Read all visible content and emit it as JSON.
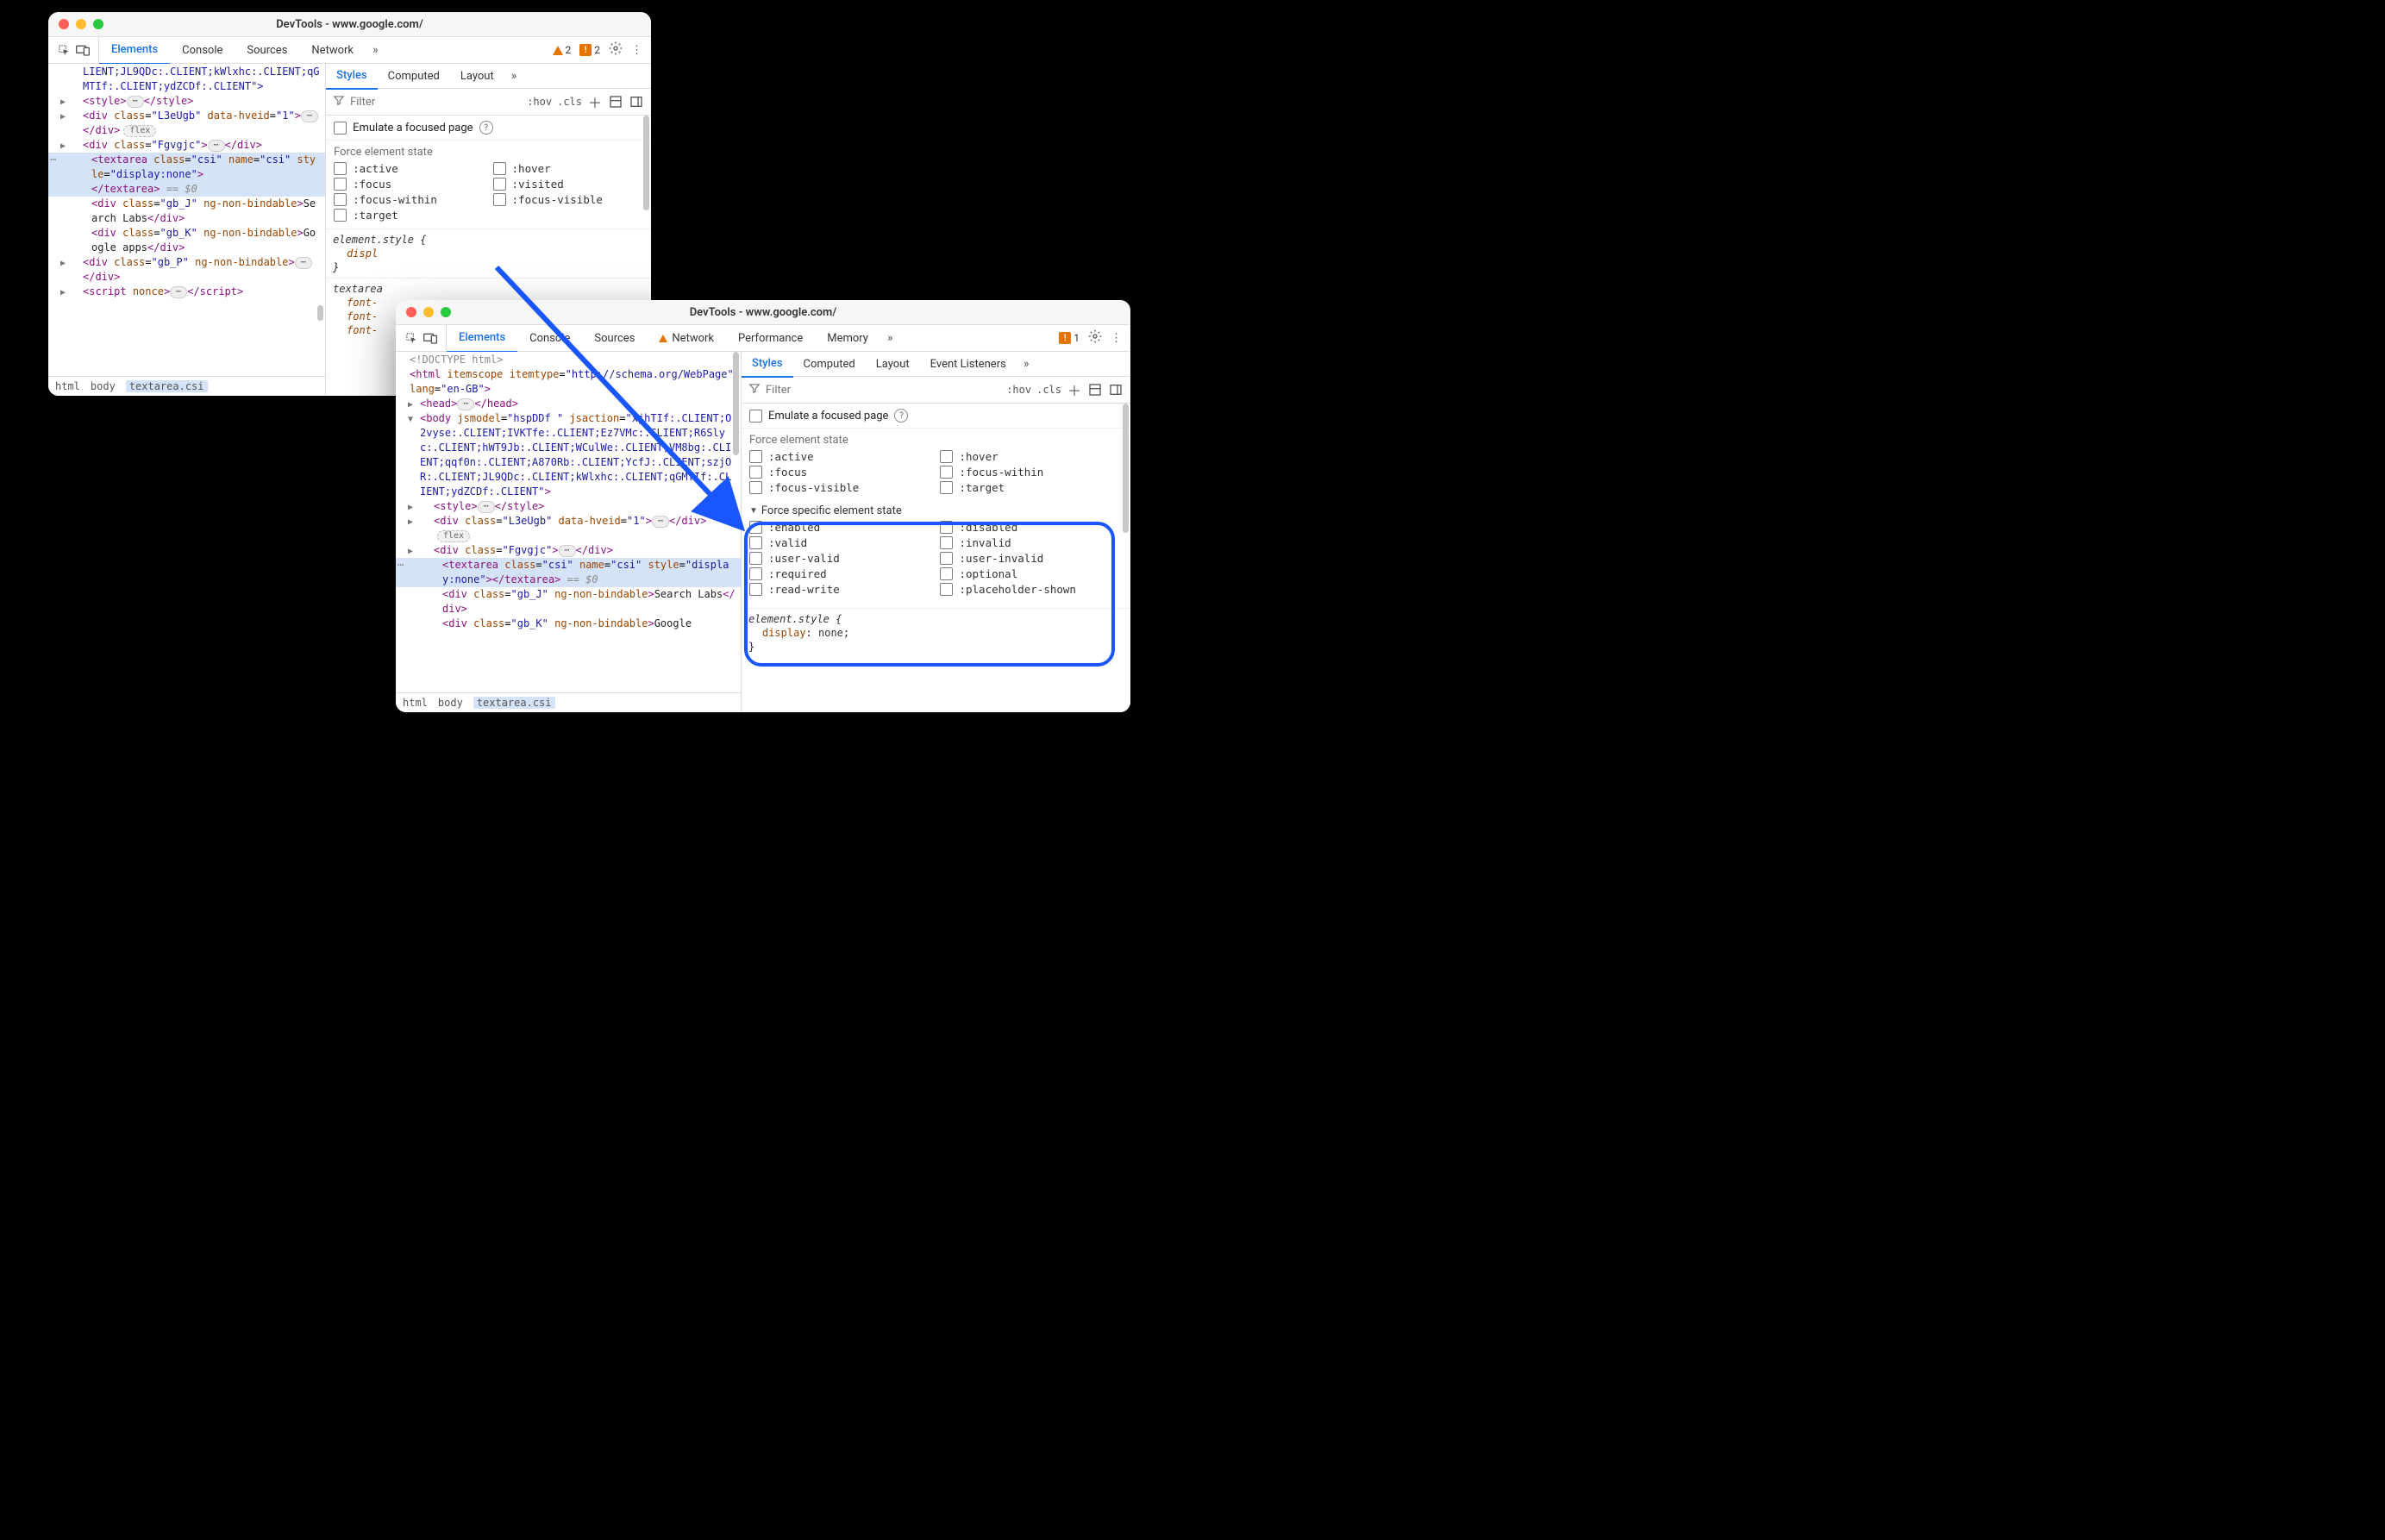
{
  "window1": {
    "title": "DevTools - www.google.com/",
    "tabs": [
      "Elements",
      "Console",
      "Sources",
      "Network"
    ],
    "active_tab": "Elements",
    "warn_count": "2",
    "issue_count": "2",
    "styles_tabs": [
      "Styles",
      "Computed",
      "Layout"
    ],
    "active_styles_tab": "Styles",
    "filter_placeholder": "Filter",
    "hov": ":hov",
    "cls": ".cls",
    "emulate_label": "Emulate a focused page",
    "force_state_head": "Force element state",
    "states_left": [
      ":active",
      ":focus",
      ":focus-within",
      ":target"
    ],
    "states_right": [
      ":hover",
      ":visited",
      ":focus-visible"
    ],
    "rule_selector": "element.style {",
    "rule_prop_partial": "displ",
    "rule_close": "}",
    "textarea_rule": "textarea",
    "textarea_props": [
      "font-",
      "font-",
      "font-"
    ],
    "breadcrumbs": [
      "html",
      "body",
      "textarea.csi"
    ],
    "flex_pill": "flex"
  },
  "window2": {
    "title": "DevTools - www.google.com/",
    "tabs": [
      "Elements",
      "Console",
      "Sources",
      "Network",
      "Performance",
      "Memory"
    ],
    "active_tab": "Elements",
    "network_warn": true,
    "issue_count": "1",
    "styles_tabs": [
      "Styles",
      "Computed",
      "Layout",
      "Event Listeners"
    ],
    "active_styles_tab": "Styles",
    "filter_placeholder": "Filter",
    "hov": ":hov",
    "cls": ".cls",
    "emulate_label": "Emulate a focused page",
    "force_state_head": "Force element state",
    "states_left": [
      ":active",
      ":focus",
      ":focus-visible"
    ],
    "states_right": [
      ":hover",
      ":focus-within",
      ":target"
    ],
    "specific_head": "Force specific element state",
    "specific_left": [
      ":enabled",
      ":valid",
      ":user-valid",
      ":required",
      ":read-write"
    ],
    "specific_right": [
      ":disabled",
      ":invalid",
      ":user-invalid",
      ":optional",
      ":placeholder-shown"
    ],
    "element_style": "element.style {",
    "style_prop": "display",
    "style_val": "none",
    "style_close": "}",
    "breadcrumbs": [
      "html",
      "body",
      "textarea.csi"
    ],
    "flex_pill": "flex"
  },
  "dom_w1": {
    "l0_tag": "<style>",
    "l0_close": "</style>",
    "l1": "<div class=\"L3eUgb\" data-hveid=\"1\">",
    "l1_close": "</div>",
    "l2": "<div class=\"Fgvgjc\">",
    "l2_close": "</div>",
    "sel_a": "<textarea class=\"csi\" name=\"csi\" style=\"display:none\">",
    "sel_b": "</textarea>",
    "sel_eq": " == $0",
    "gbJ": "<div class=\"gb_J\" ng-non-bindable>",
    "gbJ_text": "Search Labs",
    "gbJ_close": "</div>",
    "gbK": "<div class=\"gb_K\" ng-non-bindable>",
    "gbK_text": "Google apps",
    "gbK_close": "</div>",
    "gbP": "<div class=\"gb_P\" ng-non-bindable>",
    "gbP_close": "</div>",
    "script": "<script nonce>",
    "script_close": "</script>",
    "top_text": "LIENT;JL9QDc:.CLIENT;kWlxhc:.CLIENT;qGMTIf:.CLIENT;ydZCDf:.CLIENT\">"
  },
  "dom_w2": {
    "doctype": "<!DOCTYPE html>",
    "html_open": "<html itemscope itemtype=\"http://schema.org/WebPage\" lang=\"en-GB\">",
    "head": "<head>",
    "head_close": "</head>",
    "body_open": "<body jsmodel=\"hspDDf \" jsaction=\"xjhTIf:.CLIENT;O2vyse:.CLIENT;IVKTfe:.CLIENT;Ez7VMc:.CLIENT;R6Slyc:.CLIENT;hWT9Jb:.CLIENT;WCulWe:.CLIENT;VM8bg:.CLIENT;qqf0n:.CLIENT;A870Rb:.CLIENT;YcfJ:.CLIENT;szjOR:.CLIENT;JL9QDc:.CLIENT;kWlxhc:.CLIENT;qGMTIf:.CLIENT;ydZCDf:.CLIENT\">",
    "style": "<style>",
    "style_close": "</style>",
    "div1": "<div class=\"L3eUgb\" data-hveid=\"1\">",
    "div1_close": "</div>",
    "div2": "<div class=\"Fgvgjc\">",
    "div2_close": "</div>",
    "sel": "<textarea class=\"csi\" name=\"csi\" style=\"display:none\"></textarea>",
    "sel_eq": " == $0",
    "gbJ": "<div class=\"gb_J\" ng-non-bindable>",
    "gbJ_text": "Search Labs",
    "gbJ_close": "</div>",
    "gbK": "<div class=\"gb_K\" ng-non-bindable>",
    "gbK_text": "Google"
  }
}
